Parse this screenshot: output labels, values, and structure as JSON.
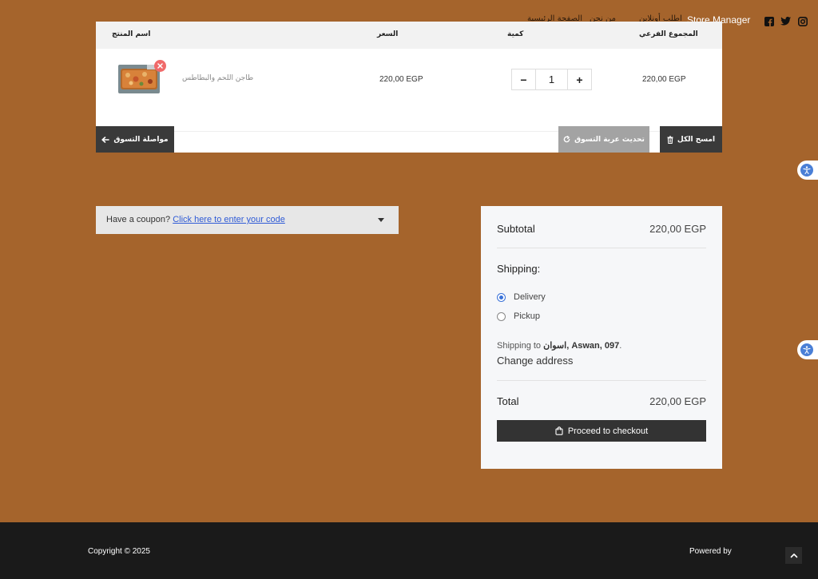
{
  "header": {
    "nav_items": [
      "الصفحة الرئيسية",
      "من نحن",
      "اطلب أونلاين"
    ],
    "store_manager": "Store Manager",
    "social_icons": [
      "facebook-icon",
      "twitter-icon",
      "instagram-icon"
    ]
  },
  "cart": {
    "columns": {
      "product": "اسم المنتج",
      "price": "السعر",
      "quantity": "كمية",
      "subtotal": "المجموع الفرعي"
    },
    "items": [
      {
        "name": "طاجن اللحم والبطاطس",
        "price": "220,00 EGP",
        "quantity": "1",
        "subtotal": "220,00 EGP"
      }
    ],
    "qty_minus": "−",
    "qty_plus": "+",
    "buttons": {
      "continue": "مواصلة التسوق",
      "update": "تحديث عربة التسوق",
      "clear": "امسح الكل"
    }
  },
  "coupon": {
    "prompt": "Have a coupon?",
    "link": "Click here to enter your code"
  },
  "totals": {
    "subtotal_label": "Subtotal",
    "subtotal_value": "220,00 EGP",
    "shipping_label": "Shipping:",
    "options": [
      {
        "label": "Delivery",
        "selected": true
      },
      {
        "label": "Pickup",
        "selected": false
      }
    ],
    "shipping_to_prefix": "Shipping to",
    "shipping_to_place": "اسوان, Aswan, 097",
    "shipping_to_suffix": ".",
    "change_address": "Change address",
    "total_label": "Total",
    "total_value": "220,00 EGP",
    "checkout": "Proceed to checkout"
  },
  "footer": {
    "copyright": "Copyright © 2025",
    "powered_by": "Powered by"
  },
  "colors": {
    "page_bg": "#a5642c",
    "dark_button": "#3a3a3a",
    "grey_button": "#a3a3a3",
    "footer_bg": "#1a1a1a",
    "link": "#2f5bd6",
    "radio_accent": "#3a72d8"
  }
}
